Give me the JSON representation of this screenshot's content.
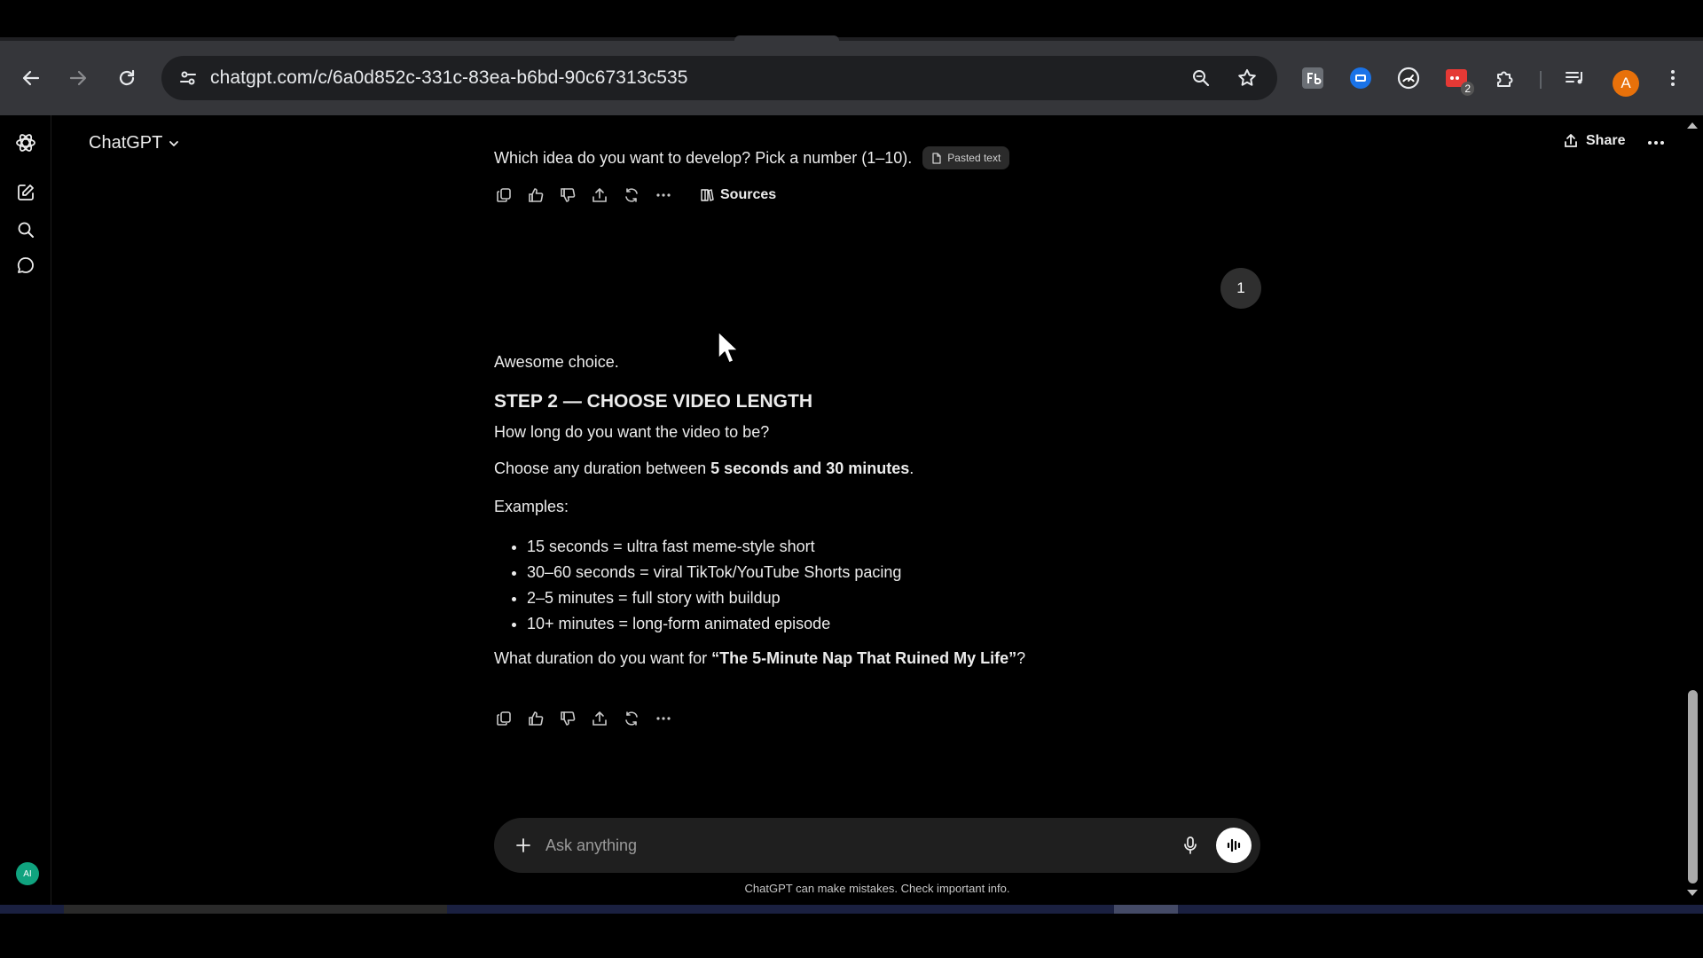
{
  "browser": {
    "url": "chatgpt.com/c/6a0d852c-331c-83ea-b6bd-90c67313c535",
    "profile_initial": "A",
    "extension_badge": "2",
    "icons": {
      "back": "back-arrow-icon",
      "forward": "forward-arrow-icon",
      "reload": "reload-icon",
      "site_info": "tune-icon",
      "zoom": "zoom-icon",
      "bookmark": "star-icon",
      "menu": "kebab-menu-icon"
    }
  },
  "sidebar": {
    "user_initials": "AI"
  },
  "header": {
    "title": "ChatGPT",
    "share_label": "Share"
  },
  "conversation": {
    "previous_line": "Which idea do you want to develop? Pick a number (1–10).",
    "pasted_chip": "Pasted text",
    "sources_label": "Sources",
    "user_message": "1",
    "reply": {
      "intro": "Awesome choice.",
      "heading": "STEP 2 — CHOOSE VIDEO LENGTH",
      "question": "How long do you want the video to be?",
      "choose_prefix": "Choose any duration between ",
      "choose_bold": "5 seconds and 30 minutes",
      "choose_suffix": ".",
      "examples_label": "Examples:",
      "examples": [
        "15 seconds = ultra fast meme-style short",
        "30–60 seconds = viral TikTok/YouTube Shorts pacing",
        "2–5 minutes = full story with buildup",
        "10+ minutes = long-form animated episode"
      ],
      "final_prefix": "What duration do you want for ",
      "final_bold": "“The 5-Minute Nap That Ruined My Life”",
      "final_suffix": "?"
    }
  },
  "composer": {
    "placeholder": "Ask anything",
    "disclaimer": "ChatGPT can make mistakes. Check important info."
  },
  "colors": {
    "background": "#000000",
    "toolbar": "#35363a",
    "omnibox": "#1e1f22",
    "composer": "#1f1f1f",
    "avatar": "#e8710a",
    "user_chip": "#10a37f"
  }
}
